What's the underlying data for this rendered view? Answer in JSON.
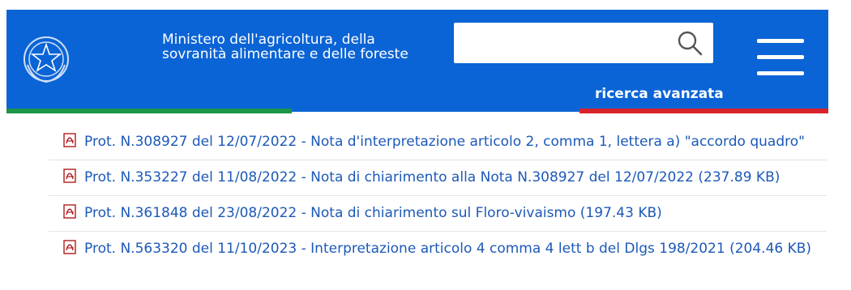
{
  "header": {
    "ministry_name": "Ministero dell'agricoltura, della sovranità alimentare e delle foreste",
    "search": {
      "value": "",
      "placeholder": ""
    },
    "advanced_search_label": "ricerca avanzata"
  },
  "documents": [
    {
      "label": "Prot. N.308927 del 12/07/2022 - Nota d'interpretazione articolo 2, comma 1, lettera a) \"accordo quadro\"",
      "icon": "pdf-icon"
    },
    {
      "label": "Prot. N.353227 del 11/08/2022 - Nota di chiarimento alla Nota N.308927 del 12/07/2022 (237.89 KB)",
      "icon": "pdf-icon"
    },
    {
      "label": "Prot. N.361848 del 23/08/2022 - Nota di chiarimento sul Floro-vivaismo (197.43 KB)",
      "icon": "pdf-icon"
    },
    {
      "label": "Prot. N.563320 del 11/10/2023 - Interpretazione articolo 4 comma 4 lett b del Dlgs 198/2021 (204.46 KB)",
      "icon": "pdf-icon"
    }
  ],
  "colors": {
    "header_blue": "#0b64d6",
    "link_blue": "#1c59b8",
    "flag_green": "#1b9547",
    "flag_red": "#d8232a"
  }
}
